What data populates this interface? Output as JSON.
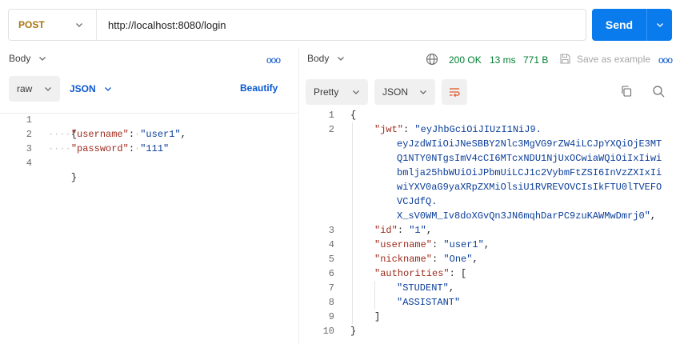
{
  "request": {
    "method": "POST",
    "url": "http://localhost:8080/login",
    "send_label": "Send"
  },
  "request_body": {
    "tab_label": "Body",
    "more_label": "ooo",
    "mode": "raw",
    "format": "JSON",
    "beautify_label": "Beautify",
    "line_numbers": [
      "1",
      "2",
      "3",
      "4"
    ],
    "lines": {
      "l1": "{",
      "l2_key": "\"username\"",
      "l2_colon": ":",
      "l2_val": "\"user1\"",
      "l2_comma": ",",
      "l3_key": "\"password\"",
      "l3_colon": ":",
      "l3_val": "\"111\"",
      "l4": "}"
    }
  },
  "response": {
    "tab_label": "Body",
    "status": "200 OK",
    "time": "13 ms",
    "size": "771 B",
    "save_label": "Save as example",
    "more_label": "ooo",
    "view_mode": "Pretty",
    "format": "JSON",
    "line_numbers": [
      "1",
      "2",
      "3",
      "4",
      "5",
      "6",
      "7",
      "8",
      "9",
      "10"
    ],
    "jwt_key": "\"jwt\"",
    "jwt_lines": [
      "\"eyJhbGciOiJIUzI1NiJ9.",
      "eyJzdWIiOiJNeSBBY2Nlc3MgVG9rZW4iLCJpYXQiOjE3MT",
      "Q1NTY0NTgsImV4cCI6MTcxNDU1NjUxOCwiaWQiOiIxIiwi",
      "bmlja25hbWUiOiJPbmUiLCJ1c2VybmFtZSI6InVzZXIxIi",
      "wiYXV0aG9yaXRpZXMiOlsiU1RVREVOVCIsIkFTU0lTVEFO",
      "VCJdfQ.",
      "X_sV0WM_Iv8doXGvQn3JN6mqhDarPC9zuKAWMwDmrj0\""
    ],
    "id_key": "\"id\"",
    "id_val": "\"1\"",
    "username_key": "\"username\"",
    "username_val": "\"user1\"",
    "nickname_key": "\"nickname\"",
    "nickname_val": "\"One\"",
    "authorities_key": "\"authorities\"",
    "authorities": [
      "\"STUDENT\"",
      "\"ASSISTANT\""
    ],
    "open_brace": "{",
    "close_brace": "}",
    "open_bracket": "[",
    "close_bracket": "]"
  },
  "colors": {
    "send": "#097bed",
    "method": "#a8740e",
    "status_ok": "#007f31",
    "json_key": "#9c2a1c",
    "json_string": "#0a3d99",
    "wrap_icon": "#e3572a"
  },
  "icons": [
    "chevron-down-icon",
    "globe-icon",
    "save-icon",
    "wrap-lines-icon",
    "copy-icon",
    "search-icon"
  ]
}
